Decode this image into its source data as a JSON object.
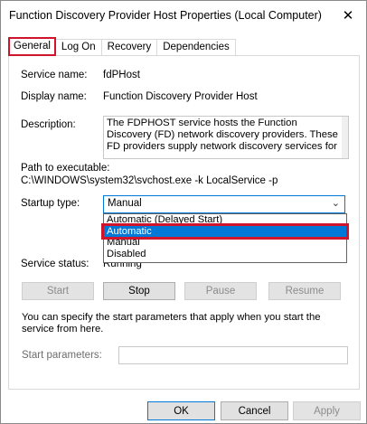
{
  "window": {
    "title": "Function Discovery Provider Host Properties (Local Computer)",
    "close_glyph": "✕"
  },
  "tabs": [
    {
      "label": "General",
      "active": true
    },
    {
      "label": "Log On"
    },
    {
      "label": "Recovery"
    },
    {
      "label": "Dependencies"
    }
  ],
  "general": {
    "service_name_label": "Service name:",
    "service_name_value": "fdPHost",
    "display_name_label": "Display name:",
    "display_name_value": "Function Discovery Provider Host",
    "description_label": "Description:",
    "description_value": "The FDPHOST service hosts the Function Discovery (FD) network discovery providers. These FD providers supply network discovery services for",
    "path_label": "Path to executable:",
    "path_value": "C:\\WINDOWS\\system32\\svchost.exe -k LocalService -p",
    "startup_type_label": "Startup type:",
    "startup_type_value": "Manual",
    "startup_options": [
      "Automatic (Delayed Start)",
      "Automatic",
      "Manual",
      "Disabled"
    ],
    "startup_selected": "Automatic",
    "service_status_label": "Service status:",
    "service_status_value": "Running"
  },
  "service_buttons": {
    "start": "Start",
    "stop": "Stop",
    "pause": "Pause",
    "resume": "Resume"
  },
  "note": "You can specify the start parameters that apply when you start the service from here.",
  "start_parameters_label": "Start parameters:",
  "dialog_buttons": {
    "ok": "OK",
    "cancel": "Cancel",
    "apply": "Apply"
  },
  "colors": {
    "accent": "#0078d7",
    "highlight_border": "#d0142c"
  }
}
